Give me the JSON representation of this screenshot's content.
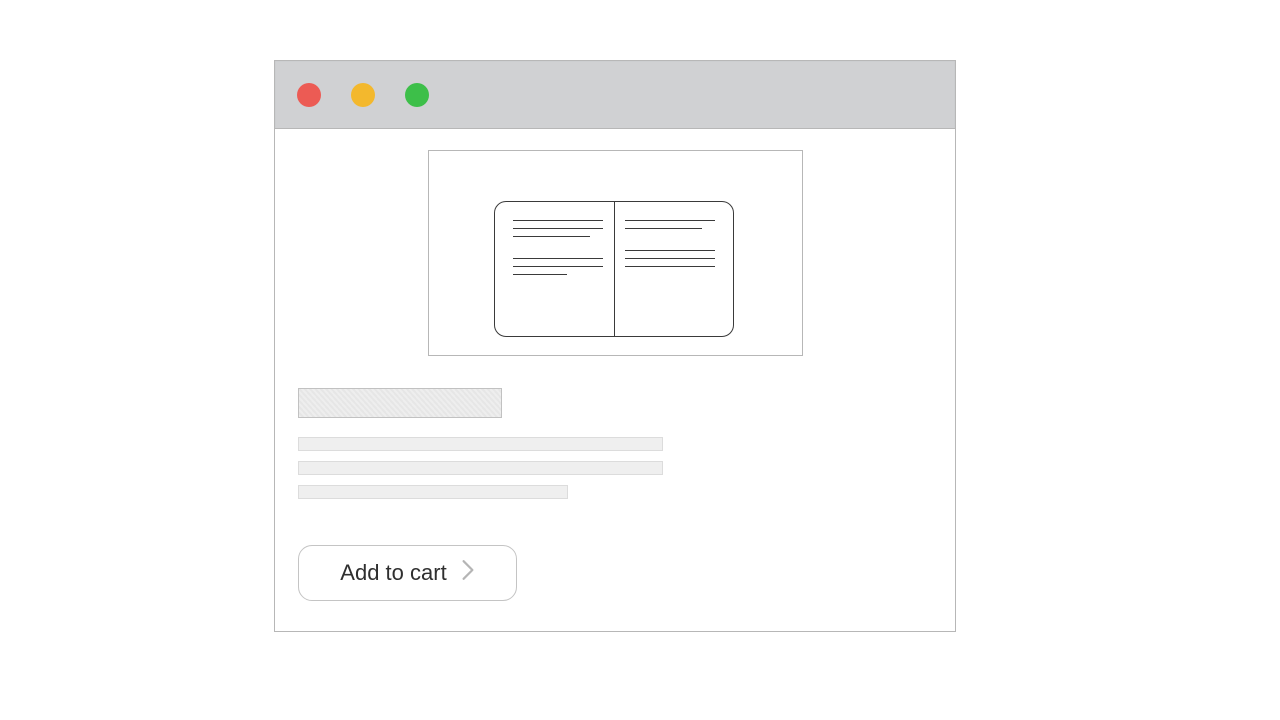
{
  "window": {
    "traffic": {
      "red": "#ec5b54",
      "yellow": "#f3b82d",
      "green": "#3dbf49"
    }
  },
  "product": {
    "image_kind": "book-icon",
    "add_to_cart_label": "Add to cart"
  }
}
